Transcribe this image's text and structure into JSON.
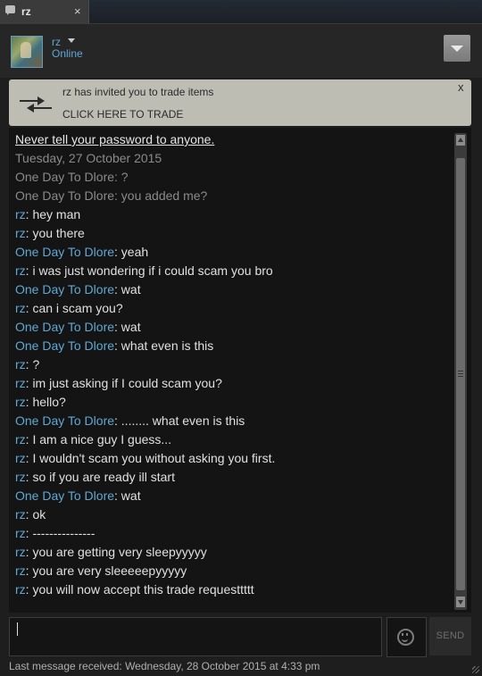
{
  "tab": {
    "title": "rz",
    "close": "×"
  },
  "friend": {
    "name": "rz",
    "status": "Online"
  },
  "trade": {
    "message": "rz has invited you to trade items",
    "link": "CLICK HERE TO TRADE",
    "close": "x"
  },
  "chat": {
    "warning": "Never tell your password to anyone.",
    "date": "Tuesday, 27 October 2015",
    "messages": [
      {
        "who": "One Day To Dlore",
        "text": ": ?",
        "old": true
      },
      {
        "who": "One Day To Dlore",
        "text": ": you added me?",
        "old": true
      },
      {
        "who": "rz",
        "text": ": hey man"
      },
      {
        "who": "rz",
        "text": ": you there"
      },
      {
        "who": "One Day To Dlore",
        "text": ": yeah"
      },
      {
        "who": "rz",
        "text": ": i was just wondering if i could scam you bro"
      },
      {
        "who": "One Day To Dlore",
        "text": ": wat"
      },
      {
        "who": "rz",
        "text": ": can i scam you?"
      },
      {
        "who": "One Day To Dlore",
        "text": ": wat"
      },
      {
        "who": "One Day To Dlore",
        "text": ": what even is this"
      },
      {
        "who": "rz",
        "text": ": ?"
      },
      {
        "who": "rz",
        "text": ": im just asking if I could scam you?"
      },
      {
        "who": "rz",
        "text": ": hello?"
      },
      {
        "who": "One Day To Dlore",
        "text": ": ........ what even is this"
      },
      {
        "who": "rz",
        "text": ": I am a nice guy I guess..."
      },
      {
        "who": "rz",
        "text": ": I wouldn't scam you without asking you first."
      },
      {
        "who": "rz",
        "text": ": so if you are ready ill start"
      },
      {
        "who": "One Day To Dlore",
        "text": ": wat"
      },
      {
        "who": "rz",
        "text": ": ok"
      },
      {
        "who": "rz",
        "text": ": ---------------"
      },
      {
        "who": "rz",
        "text": ": you are getting very sleepyyyyy"
      },
      {
        "who": "rz",
        "text": ": you are very sleeeeepyyyyy"
      },
      {
        "who": "rz",
        "text": ": you will now accept this trade requesttttt"
      }
    ]
  },
  "input": {
    "value": ""
  },
  "send_label": "SEND",
  "footer": "Last message received: Wednesday, 28 October 2015 at 4:33 pm",
  "colors": {
    "accent": "#5fa8d3",
    "background": "#1e1e1e",
    "log_background": "#141414",
    "trade_banner": "#bebdb3"
  },
  "icons": [
    "chat-bubble-icon",
    "close-icon",
    "chevron-down-icon",
    "trade-arrows-icon",
    "emoji-icon",
    "resize-grip-icon"
  ]
}
